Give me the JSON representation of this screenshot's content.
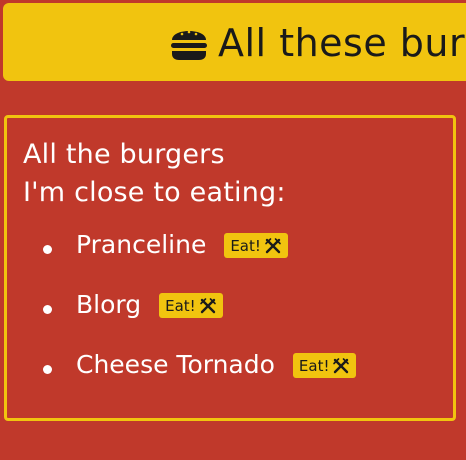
{
  "header": {
    "icon": "hamburger-icon",
    "title": "All these burg"
  },
  "panel": {
    "heading_line1": "All the burgers",
    "heading_line2": "I'm close to eating:",
    "items": [
      {
        "name": "Pranceline",
        "button_label": "Eat!",
        "button_icon": "utensils-icon"
      },
      {
        "name": "Blorg",
        "button_label": "Eat!",
        "button_icon": "utensils-icon"
      },
      {
        "name": "Cheese Tornado",
        "button_label": "Eat!",
        "button_icon": "utensils-icon"
      }
    ]
  },
  "colors": {
    "background": "#c0392b",
    "accent": "#f1c40f",
    "text": "#ffffff"
  }
}
